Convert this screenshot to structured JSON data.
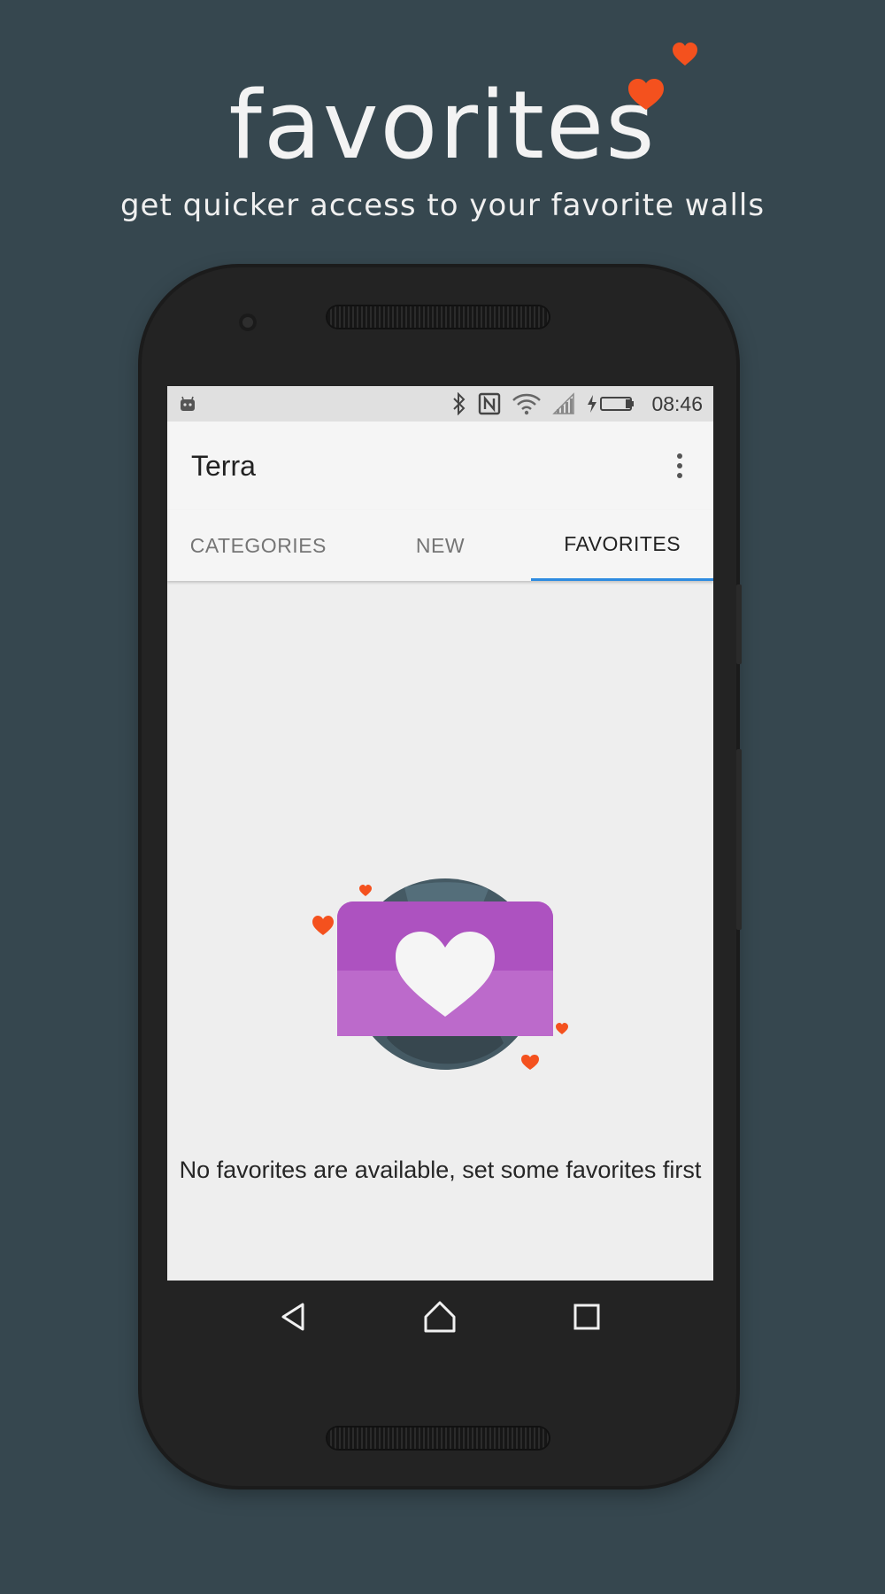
{
  "promo": {
    "headline": "favorites",
    "tagline": "get quicker access to your favorite walls"
  },
  "status_bar": {
    "time": "08:46",
    "icons": [
      "android-debug-icon",
      "bluetooth-icon",
      "nfc-icon",
      "wifi-icon",
      "signal-icon",
      "battery-charging-icon"
    ]
  },
  "app": {
    "title": "Terra",
    "overflow_icon": "more-vert-icon"
  },
  "tabs": [
    {
      "label": "CATEGORIES",
      "active": false
    },
    {
      "label": "NEW",
      "active": false
    },
    {
      "label": "FAVORITES",
      "active": true
    }
  ],
  "empty_state": {
    "message": "No favorites are available, set some favorites first",
    "illustration": "favorite-wallpaper-heart-icon"
  },
  "nav_bar": {
    "back": "back-icon",
    "home": "home-icon",
    "recents": "recents-icon"
  },
  "colors": {
    "background": "#36474f",
    "accent_heart": "#f4511e",
    "tab_indicator": "#2d8be0",
    "card_purple": "#b55ec7"
  }
}
